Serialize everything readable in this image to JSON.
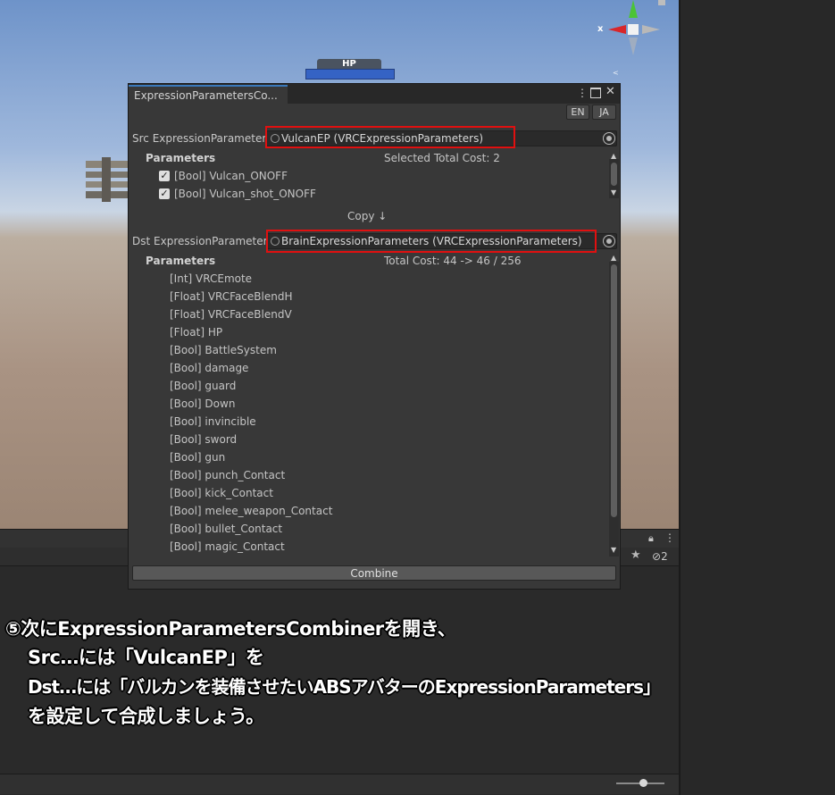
{
  "scene": {
    "hp_label": "HP",
    "gizmo_axis_label": "x"
  },
  "window": {
    "tab_title": "ExpressionParametersCo...",
    "lang_en": "EN",
    "lang_ja": "JA",
    "src": {
      "label": "Src ExpressionParameters",
      "value": "VulcanEP (VRCExpressionParameters)",
      "params_header": "Parameters",
      "cost_text": "Selected Total Cost: 2",
      "items": [
        {
          "label": "[Bool] Vulcan_ONOFF",
          "checked": true
        },
        {
          "label": "[Bool] Vulcan_shot_ONOFF",
          "checked": true
        }
      ]
    },
    "copy_label": "Copy ↓",
    "dst": {
      "label": "Dst ExpressionParameters",
      "value": "BrainExpressionParameters (VRCExpressionParameters)",
      "params_header": "Parameters",
      "cost_text": "Total Cost: 44 -> 46 / 256",
      "items": [
        "[Int] VRCEmote",
        "[Float] VRCFaceBlendH",
        "[Float] VRCFaceBlendV",
        "[Float] HP",
        "[Bool] BattleSystem",
        "[Bool] damage",
        "[Bool] guard",
        "[Bool] Down",
        "[Bool] invincible",
        "[Bool] sword",
        "[Bool] gun",
        "[Bool] punch_Contact",
        "[Bool] kick_Contact",
        "[Bool] melee_weapon_Contact",
        "[Bool] bullet_Contact",
        "[Bool] magic_Contact"
      ]
    },
    "combine_label": "Combine"
  },
  "lower_panel": {
    "hidden_count": "2"
  },
  "caption": {
    "line1": "⑤次にExpressionParametersCombinerを開き、",
    "line2": "Src…には「VulcanEP」を",
    "line3": "Dst…には「バルカンを装備させたいABSアバターのExpressionParameters」",
    "line4": "を設定して合成しましょう。"
  },
  "colors": {
    "highlight_box": "#e01010",
    "tab_accent": "#3a79bb",
    "hp_bar": "#3563c4",
    "gizmo_y": "#4bc436",
    "gizmo_x": "#d8262a"
  }
}
